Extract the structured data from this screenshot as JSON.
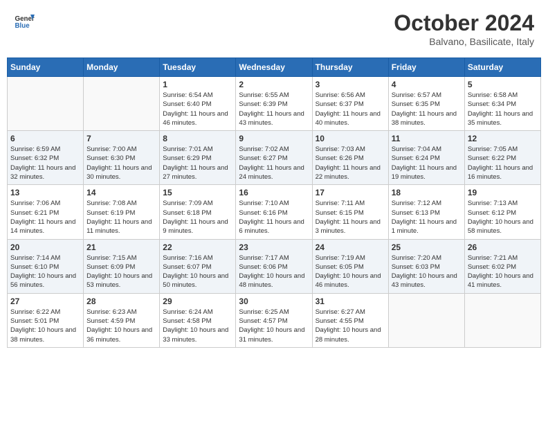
{
  "header": {
    "logo_general": "General",
    "logo_blue": "Blue",
    "month": "October 2024",
    "location": "Balvano, Basilicate, Italy"
  },
  "weekdays": [
    "Sunday",
    "Monday",
    "Tuesday",
    "Wednesday",
    "Thursday",
    "Friday",
    "Saturday"
  ],
  "weeks": [
    [
      {
        "day": "",
        "info": ""
      },
      {
        "day": "",
        "info": ""
      },
      {
        "day": "1",
        "info": "Sunrise: 6:54 AM\nSunset: 6:40 PM\nDaylight: 11 hours and 46 minutes."
      },
      {
        "day": "2",
        "info": "Sunrise: 6:55 AM\nSunset: 6:39 PM\nDaylight: 11 hours and 43 minutes."
      },
      {
        "day": "3",
        "info": "Sunrise: 6:56 AM\nSunset: 6:37 PM\nDaylight: 11 hours and 40 minutes."
      },
      {
        "day": "4",
        "info": "Sunrise: 6:57 AM\nSunset: 6:35 PM\nDaylight: 11 hours and 38 minutes."
      },
      {
        "day": "5",
        "info": "Sunrise: 6:58 AM\nSunset: 6:34 PM\nDaylight: 11 hours and 35 minutes."
      }
    ],
    [
      {
        "day": "6",
        "info": "Sunrise: 6:59 AM\nSunset: 6:32 PM\nDaylight: 11 hours and 32 minutes."
      },
      {
        "day": "7",
        "info": "Sunrise: 7:00 AM\nSunset: 6:30 PM\nDaylight: 11 hours and 30 minutes."
      },
      {
        "day": "8",
        "info": "Sunrise: 7:01 AM\nSunset: 6:29 PM\nDaylight: 11 hours and 27 minutes."
      },
      {
        "day": "9",
        "info": "Sunrise: 7:02 AM\nSunset: 6:27 PM\nDaylight: 11 hours and 24 minutes."
      },
      {
        "day": "10",
        "info": "Sunrise: 7:03 AM\nSunset: 6:26 PM\nDaylight: 11 hours and 22 minutes."
      },
      {
        "day": "11",
        "info": "Sunrise: 7:04 AM\nSunset: 6:24 PM\nDaylight: 11 hours and 19 minutes."
      },
      {
        "day": "12",
        "info": "Sunrise: 7:05 AM\nSunset: 6:22 PM\nDaylight: 11 hours and 16 minutes."
      }
    ],
    [
      {
        "day": "13",
        "info": "Sunrise: 7:06 AM\nSunset: 6:21 PM\nDaylight: 11 hours and 14 minutes."
      },
      {
        "day": "14",
        "info": "Sunrise: 7:08 AM\nSunset: 6:19 PM\nDaylight: 11 hours and 11 minutes."
      },
      {
        "day": "15",
        "info": "Sunrise: 7:09 AM\nSunset: 6:18 PM\nDaylight: 11 hours and 9 minutes."
      },
      {
        "day": "16",
        "info": "Sunrise: 7:10 AM\nSunset: 6:16 PM\nDaylight: 11 hours and 6 minutes."
      },
      {
        "day": "17",
        "info": "Sunrise: 7:11 AM\nSunset: 6:15 PM\nDaylight: 11 hours and 3 minutes."
      },
      {
        "day": "18",
        "info": "Sunrise: 7:12 AM\nSunset: 6:13 PM\nDaylight: 11 hours and 1 minute."
      },
      {
        "day": "19",
        "info": "Sunrise: 7:13 AM\nSunset: 6:12 PM\nDaylight: 10 hours and 58 minutes."
      }
    ],
    [
      {
        "day": "20",
        "info": "Sunrise: 7:14 AM\nSunset: 6:10 PM\nDaylight: 10 hours and 56 minutes."
      },
      {
        "day": "21",
        "info": "Sunrise: 7:15 AM\nSunset: 6:09 PM\nDaylight: 10 hours and 53 minutes."
      },
      {
        "day": "22",
        "info": "Sunrise: 7:16 AM\nSunset: 6:07 PM\nDaylight: 10 hours and 50 minutes."
      },
      {
        "day": "23",
        "info": "Sunrise: 7:17 AM\nSunset: 6:06 PM\nDaylight: 10 hours and 48 minutes."
      },
      {
        "day": "24",
        "info": "Sunrise: 7:19 AM\nSunset: 6:05 PM\nDaylight: 10 hours and 46 minutes."
      },
      {
        "day": "25",
        "info": "Sunrise: 7:20 AM\nSunset: 6:03 PM\nDaylight: 10 hours and 43 minutes."
      },
      {
        "day": "26",
        "info": "Sunrise: 7:21 AM\nSunset: 6:02 PM\nDaylight: 10 hours and 41 minutes."
      }
    ],
    [
      {
        "day": "27",
        "info": "Sunrise: 6:22 AM\nSunset: 5:01 PM\nDaylight: 10 hours and 38 minutes."
      },
      {
        "day": "28",
        "info": "Sunrise: 6:23 AM\nSunset: 4:59 PM\nDaylight: 10 hours and 36 minutes."
      },
      {
        "day": "29",
        "info": "Sunrise: 6:24 AM\nSunset: 4:58 PM\nDaylight: 10 hours and 33 minutes."
      },
      {
        "day": "30",
        "info": "Sunrise: 6:25 AM\nSunset: 4:57 PM\nDaylight: 10 hours and 31 minutes."
      },
      {
        "day": "31",
        "info": "Sunrise: 6:27 AM\nSunset: 4:55 PM\nDaylight: 10 hours and 28 minutes."
      },
      {
        "day": "",
        "info": ""
      },
      {
        "day": "",
        "info": ""
      }
    ]
  ]
}
